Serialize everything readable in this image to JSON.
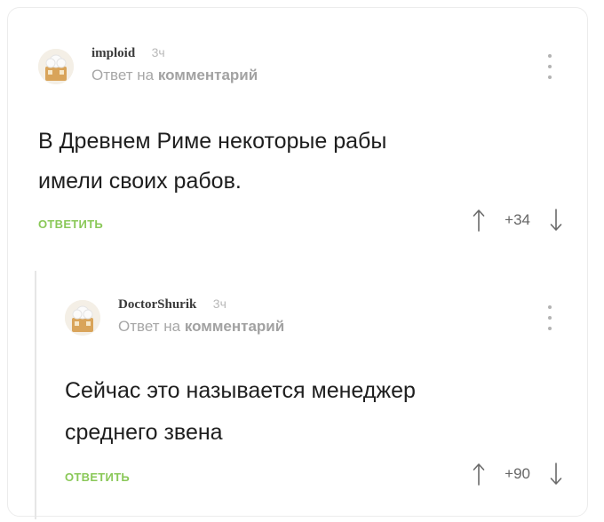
{
  "comments": [
    {
      "author": "imploid",
      "time": "3ч",
      "reply_prefix": "Ответ на",
      "reply_target": "комментарий",
      "text_lines": [
        "В Древнем Риме некоторые рабы",
        "имели своих рабов."
      ],
      "reply_label": "ОТВЕТИТЬ",
      "rating": "+34"
    },
    {
      "author": "DoctorShurik",
      "time": "3ч",
      "reply_prefix": "Ответ на",
      "reply_target": "комментарий",
      "text_lines": [
        "Сейчас это называется менеджер",
        "среднего звена"
      ],
      "reply_label": "ОТВЕТИТЬ",
      "rating": "+90"
    }
  ],
  "colors": {
    "reply_accent": "#8ac858",
    "muted_text": "#a7a7a7",
    "main_text": "#1e1e1e"
  },
  "icons": {
    "avatar": "default-chef-avatar-icon",
    "menu": "more-vertical-icon",
    "upvote": "arrow-up-icon",
    "downvote": "arrow-down-icon"
  }
}
